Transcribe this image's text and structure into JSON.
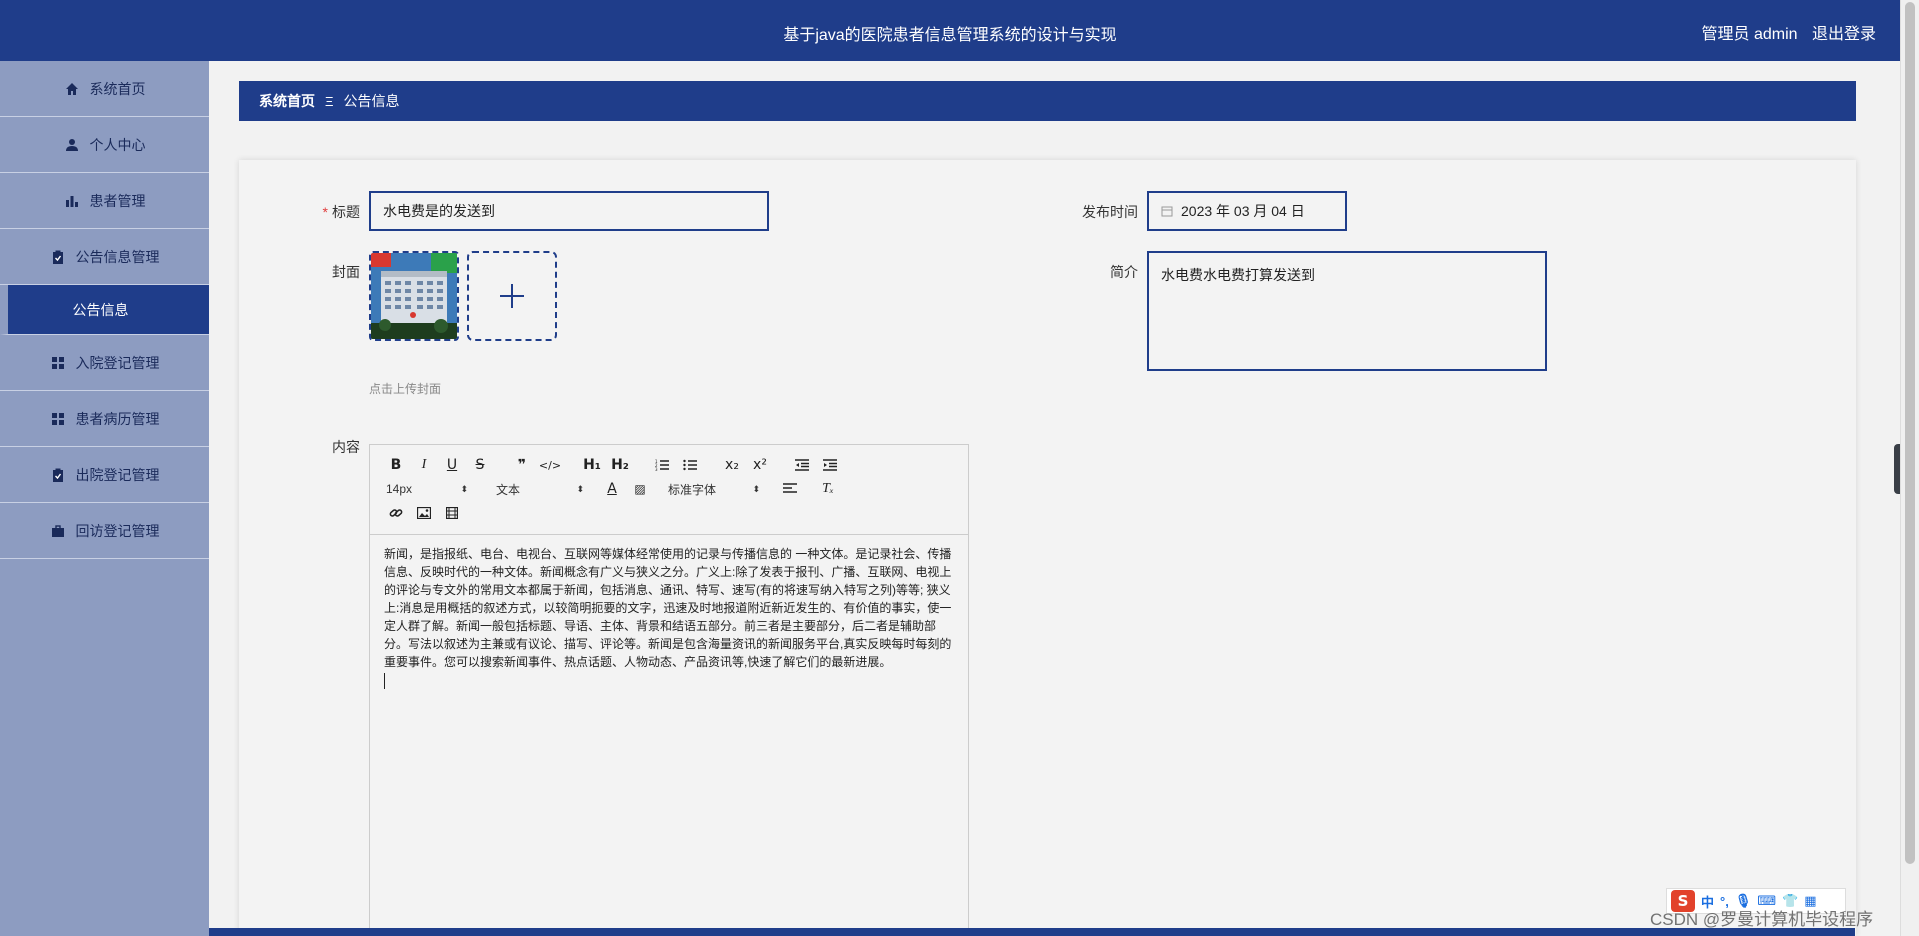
{
  "header": {
    "title": "基于java的医院患者信息管理系统的设计与实现",
    "user_label": "管理员 admin",
    "logout_label": "退出登录"
  },
  "sidebar": {
    "items": [
      {
        "label": "系统首页",
        "icon": "home-icon"
      },
      {
        "label": "个人中心",
        "icon": "user-icon"
      },
      {
        "label": "患者管理",
        "icon": "bar-chart-icon"
      },
      {
        "label": "公告信息管理",
        "icon": "clipboard-icon"
      },
      {
        "label": "公告信息",
        "icon": ""
      },
      {
        "label": "入院登记管理",
        "icon": "grid-icon"
      },
      {
        "label": "患者病历管理",
        "icon": "grid-icon"
      },
      {
        "label": "出院登记管理",
        "icon": "clipboard-icon"
      },
      {
        "label": "回访登记管理",
        "icon": "briefcase-icon"
      }
    ]
  },
  "breadcrumb": {
    "home": "系统首页",
    "separator": "Ξ",
    "current": "公告信息"
  },
  "form": {
    "title_label": "标题",
    "title_value": "水电费是的发送到",
    "publish_label": "发布时间",
    "publish_value": "2023 年 03 月 04 日",
    "cover_label": "封面",
    "cover_hint": "点击上传封面",
    "intro_label": "简介",
    "intro_value": "水电费水电费打算发送到",
    "content_label": "内容"
  },
  "editor": {
    "font_size": "14px",
    "text_style": "文本",
    "font_family": "标准字体",
    "content": "新闻，是指报纸、电台、电视台、互联网等媒体经常使用的记录与传播信息的 一种文体。是记录社会、传播信息、反映时代的一种文体。新闻概念有广义与狭义之分。广义上:除了发表于报刊、广播、互联网、电视上的评论与专文外的常用文本都属于新闻，包括消息、通讯、特写、速写(有的将速写纳入特写之列)等等; 狭义上:消息是用概括的叙述方式，以较简明扼要的文字，迅速及时地报道附近新近发生的、有价值的事实，使一定人群了解。新闻一般包括标题、导语、主体、背景和结语五部分。前三者是主要部分，后二者是辅助部分。写法以叙述为主兼或有议论、描写、评论等。新闻是包含海量资讯的新闻服务平台,真实反映每时每刻的重要事件。您可以搜索新闻事件、热点话题、人物动态、产品资讯等,快速了解它们的最新进展。"
  },
  "ime": {
    "logo": "S",
    "mode": "中"
  },
  "watermark": "CSDN @罗曼计算机毕设程序",
  "colors": {
    "primary": "#1f3d8a",
    "sidebar": "#8d9cc1",
    "required": "#e03c3c"
  }
}
